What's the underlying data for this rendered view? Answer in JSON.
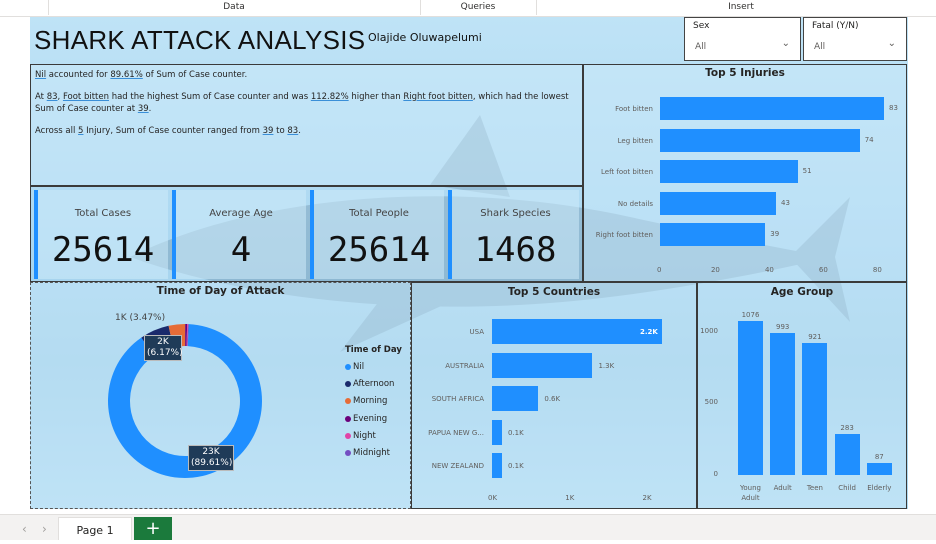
{
  "ribbon": {
    "tabs": [
      "Data",
      "Queries",
      "Insert"
    ]
  },
  "report": {
    "title": "SHARK ATTACK ANALYSIS",
    "author": "Olajide Oluwapelumi"
  },
  "slicers": {
    "sex": {
      "label": "Sex",
      "value": "All"
    },
    "fatal": {
      "label": "Fatal (Y/N)",
      "value": "All"
    }
  },
  "narrative": {
    "p1": {
      "a": "Nil",
      "b": " accounted for ",
      "c": "89.61%",
      "d": " of Sum of Case counter."
    },
    "p2": {
      "a": "At ",
      "b": "83",
      "c": ", ",
      "d": "Foot bitten",
      "e": " had the highest Sum of Case counter and was ",
      "f": "112.82%",
      "g": " higher than ",
      "h": "Right foot bitten",
      "i": ", which had the lowest Sum of Case counter at ",
      "j": "39",
      "k": "."
    },
    "p3": {
      "a": "Across all ",
      "b": "5",
      "c": " Injury, Sum of Case counter ranged from ",
      "d": "39",
      "e": " to ",
      "f": "83",
      "g": "."
    }
  },
  "kpis": [
    {
      "label": "Total Cases",
      "value": "25614"
    },
    {
      "label": "Average Age",
      "value": "4"
    },
    {
      "label": "Total People",
      "value": "25614"
    },
    {
      "label": "Shark Species",
      "value": "1468"
    }
  ],
  "injuries_chart": {
    "title": "Top 5 Injuries",
    "categories": [
      "Foot bitten",
      "Leg bitten",
      "Left foot bitten",
      "No details",
      "Right foot bitten"
    ],
    "values": [
      83,
      74,
      51,
      43,
      39
    ],
    "data_labels": [
      "83",
      "74",
      "51",
      "43",
      "39"
    ],
    "ticks": [
      "0",
      "20",
      "40",
      "60",
      "80"
    ]
  },
  "time_chart": {
    "title": "Time of Day of Attack",
    "legend_title": "Time of Day",
    "legend": [
      {
        "label": "Nil",
        "color": "#1f8fff"
      },
      {
        "label": "Afternoon",
        "color": "#1a2a6c"
      },
      {
        "label": "Morning",
        "color": "#e66c37"
      },
      {
        "label": "Evening",
        "color": "#6b007b"
      },
      {
        "label": "Night",
        "color": "#e044a7"
      },
      {
        "label": "Midnight",
        "color": "#744ec2"
      }
    ],
    "label_small": "1K (3.47%)",
    "label_mid_a": "2K",
    "label_mid_b": "(6.17%)",
    "label_big_a": "23K",
    "label_big_b": "(89.61%)"
  },
  "countries_chart": {
    "title": "Top 5 Countries",
    "categories": [
      "USA",
      "AUSTRALIA",
      "SOUTH AFRICA",
      "PAPUA NEW G...",
      "NEW ZEALAND"
    ],
    "values": [
      2.2,
      1.3,
      0.6,
      0.1,
      0.1
    ],
    "data_labels": [
      "2.2K",
      "1.3K",
      "0.6K",
      "0.1K",
      "0.1K"
    ],
    "ticks": [
      "0K",
      "1K",
      "2K"
    ]
  },
  "age_chart": {
    "title": "Age Group",
    "categories": [
      "Young Adult",
      "Adult",
      "Teen",
      "Child",
      "Elderly"
    ],
    "values": [
      1076,
      993,
      921,
      283,
      87
    ],
    "data_labels": [
      "1076",
      "993",
      "921",
      "283",
      "87"
    ],
    "ticks": [
      "1000",
      "500",
      "0"
    ]
  },
  "chart_data": [
    {
      "type": "bar",
      "title": "Top 5 Injuries",
      "categories": [
        "Foot bitten",
        "Leg bitten",
        "Left foot bitten",
        "No details",
        "Right foot bitten"
      ],
      "values": [
        83,
        74,
        51,
        43,
        39
      ],
      "xlim": [
        0,
        85
      ]
    },
    {
      "type": "pie",
      "title": "Time of Day of Attack",
      "categories": [
        "Nil",
        "Afternoon",
        "Morning",
        "Evening",
        "Night",
        "Midnight"
      ],
      "values": [
        89.61,
        6.17,
        3.47,
        0.4,
        0.2,
        0.15
      ]
    },
    {
      "type": "bar",
      "title": "Top 5 Countries",
      "categories": [
        "USA",
        "AUSTRALIA",
        "SOUTH AFRICA",
        "PAPUA NEW G...",
        "NEW ZEALAND"
      ],
      "values": [
        2200,
        1300,
        600,
        100,
        100
      ],
      "xlim": [
        0,
        2200
      ]
    },
    {
      "type": "bar",
      "title": "Age Group",
      "categories": [
        "Young Adult",
        "Adult",
        "Teen",
        "Child",
        "Elderly"
      ],
      "values": [
        1076,
        993,
        921,
        283,
        87
      ],
      "ylim": [
        0,
        1076
      ]
    }
  ],
  "pages": {
    "current": "Page 1",
    "add": "+",
    "prev": "‹",
    "next": "›"
  }
}
